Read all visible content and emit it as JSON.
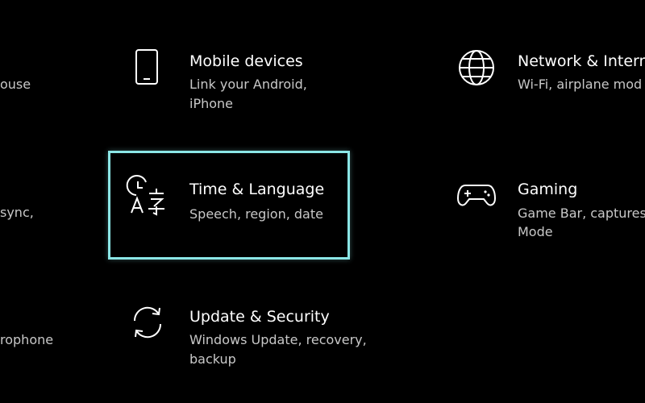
{
  "left_column_partial": [
    {
      "desc": "ouse"
    },
    {
      "desc": "sync,"
    },
    {
      "desc": "rophone"
    }
  ],
  "tiles": [
    {
      "title": "Mobile devices",
      "desc": "Link your Android, iPhone",
      "icon": "phone-icon"
    },
    {
      "title": "Network & Intern",
      "desc": "Wi-Fi, airplane mod",
      "icon": "globe-icon"
    },
    {
      "title": "Time & Language",
      "desc": "Speech, region, date",
      "icon": "time-language-icon",
      "focused": true
    },
    {
      "title": "Gaming",
      "desc": "Game Bar, captures,",
      "desc2": "Mode",
      "icon": "gamepad-icon"
    },
    {
      "title": "Update & Security",
      "desc": "Windows Update, recovery,",
      "desc2": "backup",
      "icon": "sync-arrows-icon"
    }
  ],
  "colors": {
    "background": "#000000",
    "focus_border": "#8be6e6",
    "title": "#ffffff",
    "description": "#c8c8c8",
    "icon": "#ffffff"
  }
}
